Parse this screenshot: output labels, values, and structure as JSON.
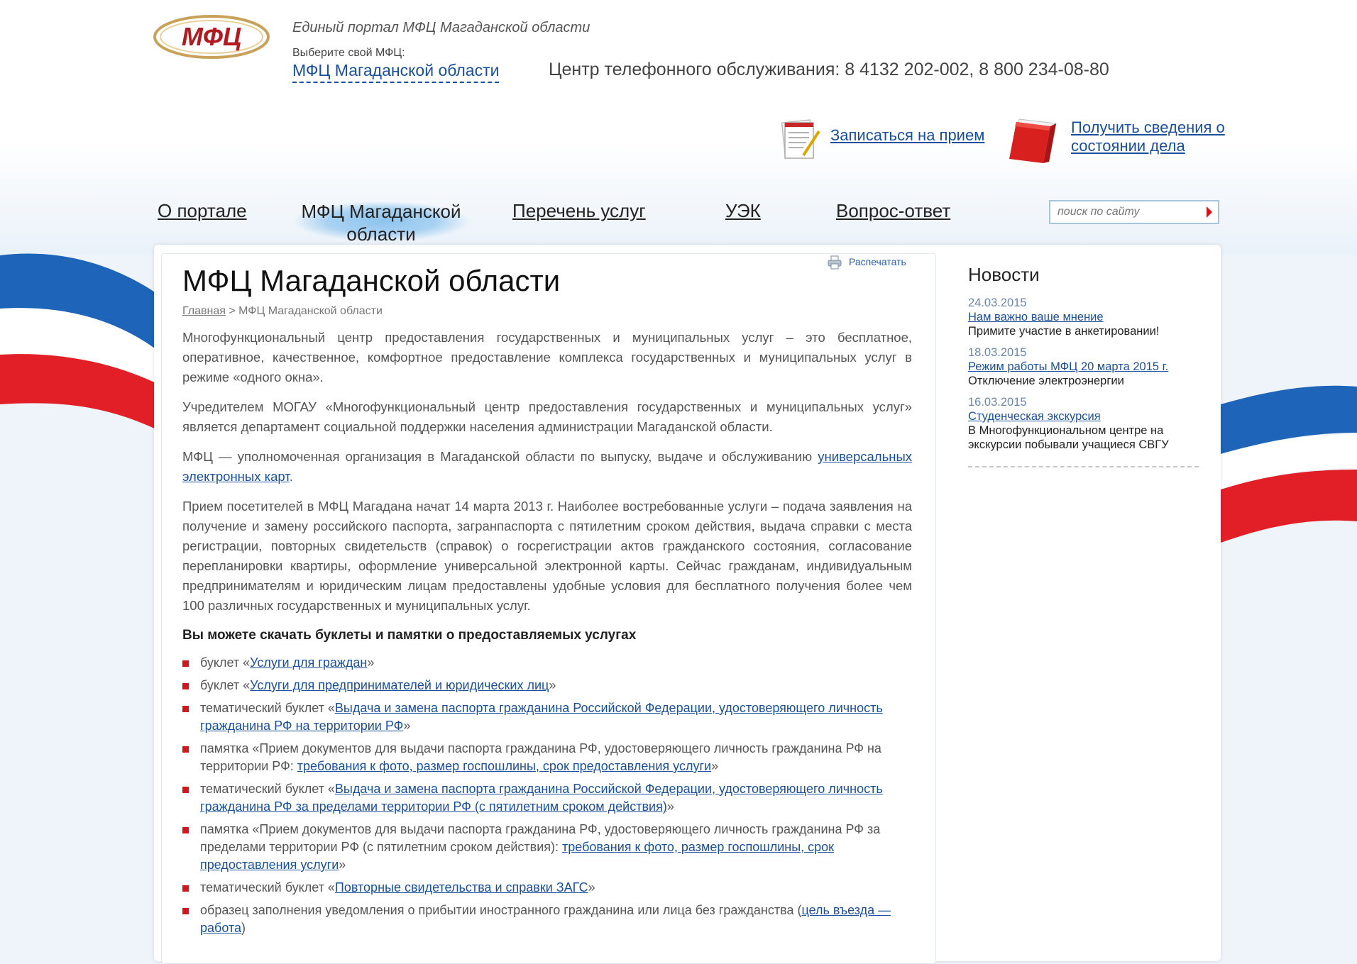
{
  "header": {
    "logo_text": "МФЦ",
    "portal_title": "Единый портал МФЦ Магаданской области",
    "choose_label": "Выберите свой МФЦ:",
    "region_select": "МФЦ Магаданской области",
    "phone_line": "Центр телефонного обслуживания: 8 4132 202-002, 8 800 234-08-80"
  },
  "actions": {
    "appointment": "Записаться на прием",
    "status": "Получить сведения о состоянии дела"
  },
  "nav": {
    "items": [
      {
        "label": "О портале"
      },
      {
        "label": "МФЦ Магаданской области"
      },
      {
        "label": "Перечень услуг"
      },
      {
        "label": "УЭК"
      },
      {
        "label": "Вопрос-ответ"
      }
    ],
    "search_placeholder": "поиск по сайту"
  },
  "content": {
    "print": "Распечатать",
    "title": "МФЦ Магаданской области",
    "breadcrumb": {
      "home": "Главная",
      "sep": " > ",
      "current": "МФЦ Магаданской области"
    },
    "p1": "Многофункциональный центр предоставления государственных и муниципальных услуг – это бесплатное, оперативное, качественное, комфортное предоставление комплекса государственных и муниципальных услуг в режиме «одного окна».",
    "p2": "Учредителем МОГАУ «Многофункциональный центр предоставления государственных и муниципальных услуг» является департамент социальной поддержки населения администрации Магаданской области.",
    "p3_text": "МФЦ — уполномоченная организация в Магаданской области по выпуску, выдаче и обслуживанию ",
    "p3_link": "универсальных электронных карт",
    "p3_end": ".",
    "p4": "Прием посетителей в МФЦ Магадана начат 14 марта 2013 г. Наиболее востребованные услуги – подача заявления на получение и замену российского паспорта, загранпаспорта с пятилетним сроком действия, выдача справки с места регистрации, повторных свидетельств (справок) о госрегистрации актов гражданского состояния, согласование перепланировки квартиры, оформление универсальной электронной карты. Сейчас гражданам, индивидуальным предпринимателям и юридическим лицам предоставлены удобные условия для бесплатного получения более чем 100 различных государственных и муниципальных услуг.",
    "downloads_heading": "Вы можете скачать буклеты и памятки о предоставляемых услугах",
    "downloads": [
      {
        "prefix": "буклет «",
        "link": "Услуги для граждан",
        "suffix": "»"
      },
      {
        "prefix": "буклет «",
        "link": "Услуги для предпринимателей и юридических лиц",
        "suffix": "»"
      },
      {
        "prefix": "тематический буклет «",
        "link": "Выдача и замена паспорта гражданина Российской Федерации, удостоверяющего личность гражданина РФ на территории РФ",
        "suffix": "»"
      },
      {
        "prefix": "памятка «Прием документов для выдачи паспорта гражданина РФ, удостоверяющего личность гражданина РФ на территории РФ: ",
        "link": "требования к фото, размер госпошлины, срок предоставления услуги",
        "suffix": "»"
      },
      {
        "prefix": "тематический буклет «",
        "link": "Выдача и замена паспорта гражданина Российской Федерации, удостоверяющего личность гражданина РФ за пределами территории РФ (с пятилетним сроком действия)",
        "suffix": "»"
      },
      {
        "prefix": "памятка «Прием документов для выдачи паспорта гражданина РФ, удостоверяющего личность гражданина РФ за пределами территории РФ (с пятилетним сроком действия): ",
        "link": "требования к фото, размер госпошлины, срок предоставления услуги",
        "suffix": "»"
      },
      {
        "prefix": "тематический буклет «",
        "link": "Повторные свидетельства и справки ЗАГС",
        "suffix": "»"
      },
      {
        "prefix": "образец заполнения уведомления о прибытии иностранного гражданина или лица без гражданства (",
        "link": "цель въезда — работа",
        "suffix": ")"
      }
    ]
  },
  "news": {
    "title": "Новости",
    "items": [
      {
        "date": "24.03.2015",
        "link": "Нам важно ваше мнение",
        "desc": "Примите участие в анкетировании!"
      },
      {
        "date": "18.03.2015",
        "link": "Режим работы МФЦ 20 марта 2015 г.",
        "desc": "Отключение электроэнергии"
      },
      {
        "date": "16.03.2015",
        "link": "Студенческая экскурсия",
        "desc": "В Многофункциональном центре на экскурсии побывали учащиеся СВГУ"
      }
    ]
  },
  "colors": {
    "accent_red": "#d4161c",
    "link_blue": "#1a4f9c",
    "flag_blue": "#1a5fb0"
  }
}
